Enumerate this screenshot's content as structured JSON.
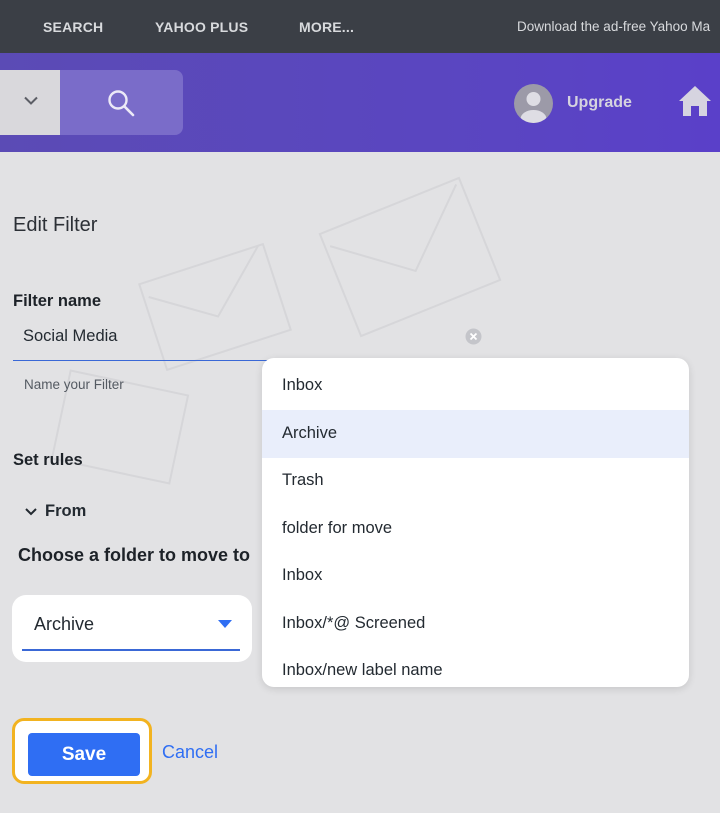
{
  "topnav": {
    "links": [
      "SEARCH",
      "YAHOO PLUS",
      "MORE..."
    ],
    "promo": "Download the ad-free Yahoo Ma"
  },
  "header": {
    "upgrade_label": "Upgrade"
  },
  "edit_filter": {
    "title": "Edit Filter",
    "filter_name_label": "Filter name",
    "filter_name_value": "Social Media",
    "filter_name_hint": "Name your Filter",
    "set_rules_label": "Set rules",
    "from_label": "From",
    "choose_folder_label": "Choose a folder to move to",
    "selected_folder": "Archive",
    "save_label": "Save",
    "cancel_label": "Cancel"
  },
  "dropdown": {
    "selected_index": 1,
    "options": [
      "Inbox",
      "Archive",
      "Trash",
      "folder for move",
      "Inbox",
      "Inbox/*@ Screened",
      "Inbox/new label name"
    ]
  },
  "colors": {
    "accent_blue": "#2f6ef3",
    "focus_ring": "#f2b320",
    "header_purple": "#5a45c2",
    "topnav_dark": "#3b3f46"
  }
}
